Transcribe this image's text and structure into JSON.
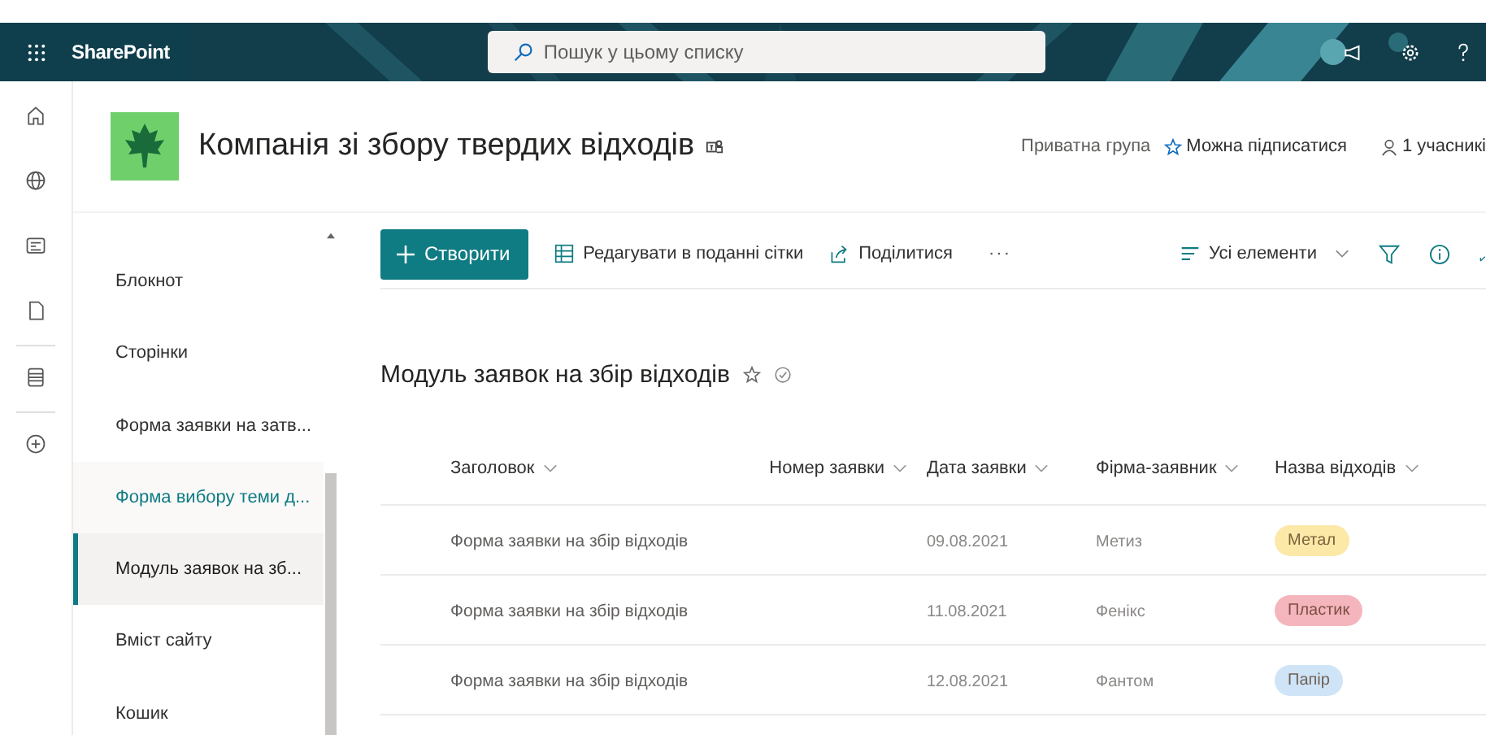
{
  "suite_bar": {
    "app_name": "SharePoint",
    "search": {
      "placeholder": "Пошук у цьому списку"
    }
  },
  "site": {
    "title": "Компанія зі збору твердих відходів",
    "privacy": "Приватна група",
    "follow": "Можна підписатися",
    "members": "1 учасникі"
  },
  "navigation": [
    {
      "label": "Блокнот",
      "selected": false,
      "hovered": false
    },
    {
      "label": "Сторінки",
      "selected": false,
      "hovered": false
    },
    {
      "label": "Форма заявки на затв...",
      "selected": false,
      "hovered": false
    },
    {
      "label": "Форма вибору теми д...",
      "selected": false,
      "hovered": true
    },
    {
      "label": "Модуль заявок на зб...",
      "selected": true,
      "hovered": false
    },
    {
      "label": "Вміст сайту",
      "selected": false,
      "hovered": false
    },
    {
      "label": "Кошик",
      "selected": false,
      "hovered": false
    }
  ],
  "command_bar": {
    "new": "Створити",
    "grid_edit": "Редагувати в поданні сітки",
    "share": "Поділитися",
    "more": "···",
    "view": "Усі елементи"
  },
  "list": {
    "title": "Модуль заявок на збір відходів",
    "columns": [
      "Заголовок",
      "Номер заявки",
      "Дата заявки",
      "Фірма-заявник",
      "Назва відходів"
    ],
    "rows": [
      {
        "title": "Форма заявки на збір відходів",
        "date": "09.08.2021",
        "company": "Метиз",
        "waste": {
          "label": "Метал",
          "color": "#fce9a8"
        }
      },
      {
        "title": "Форма заявки на збір відходів",
        "date": "11.08.2021",
        "company": "Фенікс",
        "waste": {
          "label": "Пластик",
          "color": "#f5b5bd"
        }
      },
      {
        "title": "Форма заявки на збір відходів",
        "date": "12.08.2021",
        "company": "Фантом",
        "waste": {
          "label": "Папір",
          "color": "#cfe4f7"
        }
      }
    ]
  }
}
